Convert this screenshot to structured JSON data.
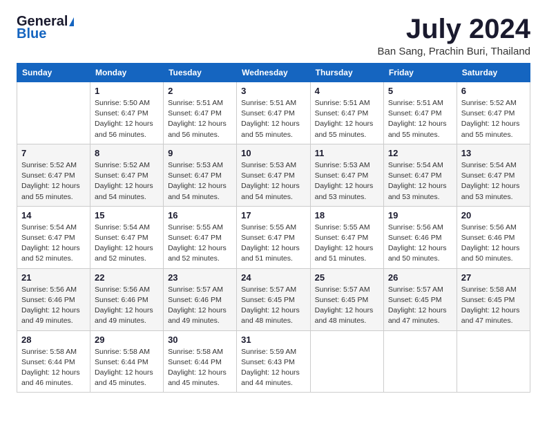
{
  "logo": {
    "general": "General",
    "blue": "Blue"
  },
  "header": {
    "month": "July 2024",
    "location": "Ban Sang, Prachin Buri, Thailand"
  },
  "days_of_week": [
    "Sunday",
    "Monday",
    "Tuesday",
    "Wednesday",
    "Thursday",
    "Friday",
    "Saturday"
  ],
  "weeks": [
    [
      {
        "day": "",
        "detail": ""
      },
      {
        "day": "1",
        "detail": "Sunrise: 5:50 AM\nSunset: 6:47 PM\nDaylight: 12 hours\nand 56 minutes."
      },
      {
        "day": "2",
        "detail": "Sunrise: 5:51 AM\nSunset: 6:47 PM\nDaylight: 12 hours\nand 56 minutes."
      },
      {
        "day": "3",
        "detail": "Sunrise: 5:51 AM\nSunset: 6:47 PM\nDaylight: 12 hours\nand 55 minutes."
      },
      {
        "day": "4",
        "detail": "Sunrise: 5:51 AM\nSunset: 6:47 PM\nDaylight: 12 hours\nand 55 minutes."
      },
      {
        "day": "5",
        "detail": "Sunrise: 5:51 AM\nSunset: 6:47 PM\nDaylight: 12 hours\nand 55 minutes."
      },
      {
        "day": "6",
        "detail": "Sunrise: 5:52 AM\nSunset: 6:47 PM\nDaylight: 12 hours\nand 55 minutes."
      }
    ],
    [
      {
        "day": "7",
        "detail": "Sunrise: 5:52 AM\nSunset: 6:47 PM\nDaylight: 12 hours\nand 55 minutes."
      },
      {
        "day": "8",
        "detail": "Sunrise: 5:52 AM\nSunset: 6:47 PM\nDaylight: 12 hours\nand 54 minutes."
      },
      {
        "day": "9",
        "detail": "Sunrise: 5:53 AM\nSunset: 6:47 PM\nDaylight: 12 hours\nand 54 minutes."
      },
      {
        "day": "10",
        "detail": "Sunrise: 5:53 AM\nSunset: 6:47 PM\nDaylight: 12 hours\nand 54 minutes."
      },
      {
        "day": "11",
        "detail": "Sunrise: 5:53 AM\nSunset: 6:47 PM\nDaylight: 12 hours\nand 53 minutes."
      },
      {
        "day": "12",
        "detail": "Sunrise: 5:54 AM\nSunset: 6:47 PM\nDaylight: 12 hours\nand 53 minutes."
      },
      {
        "day": "13",
        "detail": "Sunrise: 5:54 AM\nSunset: 6:47 PM\nDaylight: 12 hours\nand 53 minutes."
      }
    ],
    [
      {
        "day": "14",
        "detail": "Sunrise: 5:54 AM\nSunset: 6:47 PM\nDaylight: 12 hours\nand 52 minutes."
      },
      {
        "day": "15",
        "detail": "Sunrise: 5:54 AM\nSunset: 6:47 PM\nDaylight: 12 hours\nand 52 minutes."
      },
      {
        "day": "16",
        "detail": "Sunrise: 5:55 AM\nSunset: 6:47 PM\nDaylight: 12 hours\nand 52 minutes."
      },
      {
        "day": "17",
        "detail": "Sunrise: 5:55 AM\nSunset: 6:47 PM\nDaylight: 12 hours\nand 51 minutes."
      },
      {
        "day": "18",
        "detail": "Sunrise: 5:55 AM\nSunset: 6:47 PM\nDaylight: 12 hours\nand 51 minutes."
      },
      {
        "day": "19",
        "detail": "Sunrise: 5:56 AM\nSunset: 6:46 PM\nDaylight: 12 hours\nand 50 minutes."
      },
      {
        "day": "20",
        "detail": "Sunrise: 5:56 AM\nSunset: 6:46 PM\nDaylight: 12 hours\nand 50 minutes."
      }
    ],
    [
      {
        "day": "21",
        "detail": "Sunrise: 5:56 AM\nSunset: 6:46 PM\nDaylight: 12 hours\nand 49 minutes."
      },
      {
        "day": "22",
        "detail": "Sunrise: 5:56 AM\nSunset: 6:46 PM\nDaylight: 12 hours\nand 49 minutes."
      },
      {
        "day": "23",
        "detail": "Sunrise: 5:57 AM\nSunset: 6:46 PM\nDaylight: 12 hours\nand 49 minutes."
      },
      {
        "day": "24",
        "detail": "Sunrise: 5:57 AM\nSunset: 6:45 PM\nDaylight: 12 hours\nand 48 minutes."
      },
      {
        "day": "25",
        "detail": "Sunrise: 5:57 AM\nSunset: 6:45 PM\nDaylight: 12 hours\nand 48 minutes."
      },
      {
        "day": "26",
        "detail": "Sunrise: 5:57 AM\nSunset: 6:45 PM\nDaylight: 12 hours\nand 47 minutes."
      },
      {
        "day": "27",
        "detail": "Sunrise: 5:58 AM\nSunset: 6:45 PM\nDaylight: 12 hours\nand 47 minutes."
      }
    ],
    [
      {
        "day": "28",
        "detail": "Sunrise: 5:58 AM\nSunset: 6:44 PM\nDaylight: 12 hours\nand 46 minutes."
      },
      {
        "day": "29",
        "detail": "Sunrise: 5:58 AM\nSunset: 6:44 PM\nDaylight: 12 hours\nand 45 minutes."
      },
      {
        "day": "30",
        "detail": "Sunrise: 5:58 AM\nSunset: 6:44 PM\nDaylight: 12 hours\nand 45 minutes."
      },
      {
        "day": "31",
        "detail": "Sunrise: 5:59 AM\nSunset: 6:43 PM\nDaylight: 12 hours\nand 44 minutes."
      },
      {
        "day": "",
        "detail": ""
      },
      {
        "day": "",
        "detail": ""
      },
      {
        "day": "",
        "detail": ""
      }
    ]
  ]
}
